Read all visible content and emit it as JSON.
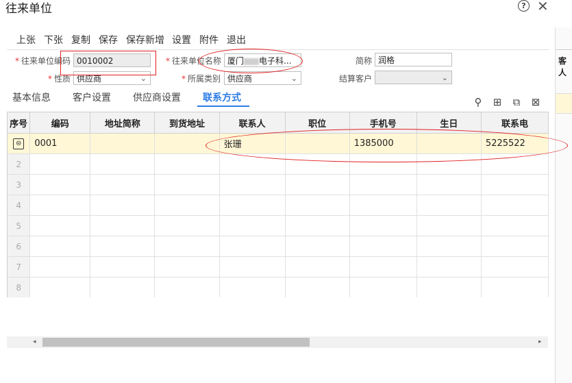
{
  "window": {
    "title": "往来单位"
  },
  "toolbar": {
    "buttons": [
      "上张",
      "下张",
      "复制",
      "保存",
      "保存新增",
      "设置",
      "附件",
      "退出"
    ]
  },
  "form": {
    "code_label": "往来单位编码",
    "code_value": "0010002",
    "name_label": "往来单位名称",
    "name_prefix": "厦门",
    "name_suffix": "电子科...",
    "short_label": "简称",
    "short_value": "润格",
    "nature_label": "性质",
    "nature_value": "供应商",
    "category_label": "所属类别",
    "category_value": "供应商",
    "settle_label": "结算客户",
    "settle_value": ""
  },
  "tabs": [
    "基本信息",
    "客户设置",
    "供应商设置",
    "联系方式"
  ],
  "table": {
    "headers": [
      "序号",
      "编码",
      "地址简称",
      "到货地址",
      "联系人",
      "职位",
      "手机号",
      "生日",
      "联系电"
    ],
    "rows": [
      [
        "",
        "0001",
        "",
        "",
        "张珊",
        "",
        "1385000",
        "",
        "5225522"
      ],
      [
        "2",
        "",
        "",
        "",
        "",
        "",
        "",
        "",
        ""
      ],
      [
        "3",
        "",
        "",
        "",
        "",
        "",
        "",
        "",
        ""
      ],
      [
        "4",
        "",
        "",
        "",
        "",
        "",
        "",
        "",
        ""
      ],
      [
        "5",
        "",
        "",
        "",
        "",
        "",
        "",
        "",
        ""
      ],
      [
        "6",
        "",
        "",
        "",
        "",
        "",
        "",
        "",
        ""
      ],
      [
        "7",
        "",
        "",
        "",
        "",
        "",
        "",
        "",
        ""
      ],
      [
        "8",
        "",
        "",
        "",
        "",
        "",
        "",
        "",
        ""
      ]
    ]
  },
  "side_panel": {
    "tab_label": "客人"
  },
  "icons": [
    "help-icon",
    "close-icon",
    "location-icon",
    "add-row-icon",
    "copy-row-icon",
    "delete-row-icon"
  ],
  "colors": {
    "accent": "#2d7be5",
    "selected_row": "#fff7d6",
    "annotation": "#e02020"
  }
}
